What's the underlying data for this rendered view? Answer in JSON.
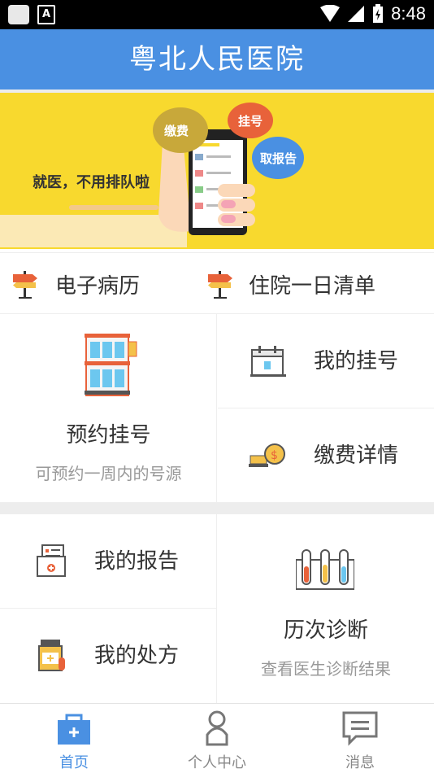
{
  "status_bar": {
    "time": "8:48",
    "notification_letter": "A"
  },
  "header": {
    "title": "粤北人民医院"
  },
  "banner": {
    "slogan": "就医，不用排队啦",
    "bubbles": [
      "缴费",
      "挂号",
      "取报告"
    ]
  },
  "quick_links": [
    {
      "label": "电子病历",
      "icon": "signpost-icon"
    },
    {
      "label": "住院一日清单",
      "icon": "signpost-icon"
    }
  ],
  "services": {
    "appointment": {
      "title": "预约挂号",
      "subtitle": "可预约一周内的号源"
    },
    "my_registration": {
      "label": "我的挂号"
    },
    "payment_details": {
      "label": "缴费详情"
    },
    "my_report": {
      "label": "我的报告"
    },
    "my_prescription": {
      "label": "我的处方"
    },
    "diagnosis_history": {
      "title": "历次诊断",
      "subtitle": "查看医生诊断结果"
    }
  },
  "tabs": [
    {
      "label": "首页",
      "icon": "medical-kit-icon",
      "active": true
    },
    {
      "label": "个人中心",
      "icon": "person-icon",
      "active": false
    },
    {
      "label": "消息",
      "icon": "message-icon",
      "active": false
    }
  ],
  "colors": {
    "primary": "#4a90e2",
    "banner": "#f8d92e",
    "accent_red": "#e8623a"
  }
}
